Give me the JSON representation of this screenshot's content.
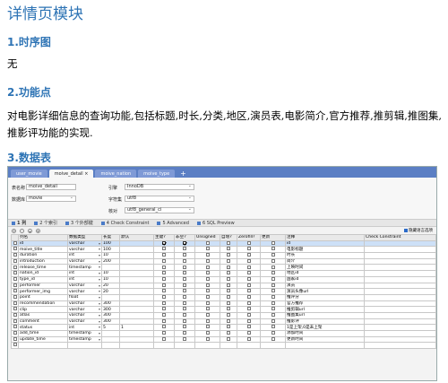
{
  "page_title": "详情页模块",
  "sec1": {
    "heading": "1.时序图",
    "text": "无"
  },
  "sec2": {
    "heading": "2.功能点",
    "text": "对电影详细信息的查询功能,包括标题,时长,分类,地区,演员表,电影简介,官方推荐,推剪辑,推图集,推影评功能的实现."
  },
  "sec3": {
    "heading": "3.数据表"
  },
  "screenshot": {
    "tabs": [
      {
        "label": "user_movie"
      },
      {
        "label": "moive_detail ×"
      },
      {
        "label": "moive_nation"
      },
      {
        "label": "moive_type"
      }
    ],
    "tab_plus": "+",
    "form": {
      "table_name_label": "表名称",
      "table_name_value": "moive_detail",
      "engine_label": "引擎",
      "engine_value": "InnoDB",
      "database_label": "数据库",
      "database_value": "movie",
      "charset_label": "字符集",
      "charset_value": "utf8",
      "collation_label": "核对",
      "collation_value": "utf8_general_ci"
    },
    "toolbar": [
      "1 列",
      "2 个索引",
      "3 个外部键",
      "4 Check Constraint",
      "5 Advanced",
      "6 SQL Preview"
    ],
    "hide_lang_option": "隐藏语言选项",
    "columns": [
      "",
      "列名",
      "数据类型",
      "长度",
      "默认",
      "主键?",
      "非空?",
      "Unsigned",
      "自增?",
      "Zerofill?",
      "更新",
      "注释",
      "Check Constraint"
    ],
    "rows": [
      {
        "name": "id",
        "type": "varchar",
        "len": "100",
        "def": "",
        "pk": true,
        "nn": true,
        "comment": "id"
      },
      {
        "name": "moive_title",
        "type": "varchar",
        "len": "100",
        "def": "",
        "pk": false,
        "nn": false,
        "comment": "电影标题"
      },
      {
        "name": "duration",
        "type": "int",
        "len": "10",
        "def": "",
        "pk": false,
        "nn": false,
        "comment": "时长"
      },
      {
        "name": "introduction",
        "type": "varchar",
        "len": "200",
        "def": "",
        "pk": false,
        "nn": false,
        "comment": "简介"
      },
      {
        "name": "release_time",
        "type": "timestamp",
        "len": "",
        "def": "",
        "pk": false,
        "nn": false,
        "comment": "上映时间"
      },
      {
        "name": "nation_id",
        "type": "int",
        "len": "10",
        "def": "",
        "pk": false,
        "nn": false,
        "comment": "地区id"
      },
      {
        "name": "type_id",
        "type": "int",
        "len": "10",
        "def": "",
        "pk": false,
        "nn": false,
        "comment": "国家id"
      },
      {
        "name": "performer",
        "type": "varchar",
        "len": "20",
        "def": "",
        "pk": false,
        "nn": false,
        "comment": "演员"
      },
      {
        "name": "performer_img",
        "type": "varchar",
        "len": "20",
        "def": "",
        "pk": false,
        "nn": false,
        "comment": "演员头像url"
      },
      {
        "name": "point",
        "type": "float",
        "len": "",
        "def": "",
        "pk": false,
        "nn": false,
        "comment": "推评分"
      },
      {
        "name": "recommendation",
        "type": "varchar",
        "len": "300",
        "def": "",
        "pk": false,
        "nn": false,
        "comment": "官方推荐"
      },
      {
        "name": "clip",
        "type": "varchar",
        "len": "300",
        "def": "",
        "pk": false,
        "nn": false,
        "comment": "推剪辑url"
      },
      {
        "name": "atlas",
        "type": "varchar",
        "len": "300",
        "def": "",
        "pk": false,
        "nn": false,
        "comment": "推图集url"
      },
      {
        "name": "comment",
        "type": "varchar",
        "len": "300",
        "def": "",
        "pk": false,
        "nn": false,
        "comment": "推影评"
      },
      {
        "name": "status",
        "type": "int",
        "len": "5",
        "def": "1",
        "pk": false,
        "nn": false,
        "comment": "1是上架,0是未上架"
      },
      {
        "name": "add_time",
        "type": "timestamp",
        "len": "",
        "def": "",
        "pk": false,
        "nn": false,
        "comment": "添加时间"
      },
      {
        "name": "update_time",
        "type": "timestamp",
        "len": "",
        "def": "",
        "pk": false,
        "nn": false,
        "comment": "更新时间"
      }
    ]
  }
}
